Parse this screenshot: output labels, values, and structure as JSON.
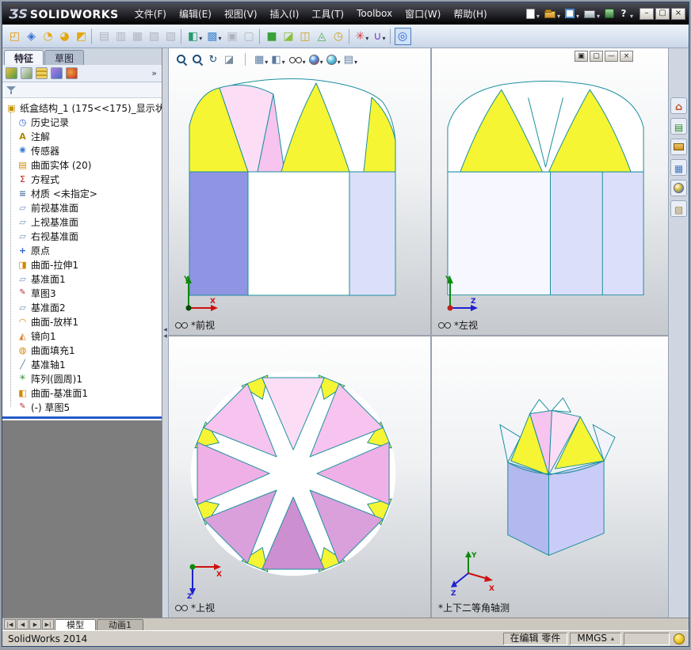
{
  "titlebar": {
    "logo_mark": "ƷS",
    "logo_name": "SOLIDWORKS",
    "quick_icons": [
      {
        "name": "new-document-button",
        "k": "q-new",
        "dd": true
      },
      {
        "name": "open-button",
        "k": "q-open",
        "dd": true
      },
      {
        "name": "make-drawing-button",
        "k": "q-opt",
        "dd": true
      },
      {
        "name": "print-button",
        "k": "q-print",
        "dd": true
      },
      {
        "name": "rebuild-button",
        "k": "q-reb",
        "dd": false
      },
      {
        "name": "help-button",
        "k": "q-help",
        "dd": true
      }
    ],
    "window_buttons": [
      {
        "name": "minimize-button",
        "g": "–"
      },
      {
        "name": "maximize-button",
        "g": "▢"
      },
      {
        "name": "close-button",
        "g": "×"
      }
    ]
  },
  "menubar": {
    "items": [
      {
        "name": "menu-file",
        "label": "文件(F)"
      },
      {
        "name": "menu-edit",
        "label": "编辑(E)"
      },
      {
        "name": "menu-view",
        "label": "视图(V)"
      },
      {
        "name": "menu-insert",
        "label": "插入(I)"
      },
      {
        "name": "menu-tools",
        "label": "工具(T)"
      },
      {
        "name": "menu-toolbox",
        "label": "Toolbox"
      },
      {
        "name": "menu-window",
        "label": "窗口(W)"
      },
      {
        "name": "menu-help",
        "label": "帮助(H)"
      }
    ]
  },
  "toolbar": {
    "items": [
      {
        "name": "toolbar-tool-button",
        "g": "◰",
        "c": "#e39a10"
      },
      {
        "name": "toolbar-tool-button",
        "g": "◈",
        "c": "#3a6fd0"
      },
      {
        "name": "toolbar-tool-button",
        "g": "◔",
        "c": "#e3a810"
      },
      {
        "name": "toolbar-tool-button",
        "g": "◕",
        "c": "#e3a810"
      },
      {
        "name": "toolbar-tool-button",
        "g": "◩",
        "c": "#e3a810"
      },
      {
        "name": "toolbar-separator",
        "cls": "sep",
        "it": "false"
      },
      {
        "name": "toolbar-tool-button",
        "g": "▤",
        "c": "#a7adb6",
        "cls": "disabled"
      },
      {
        "name": "toolbar-tool-button",
        "g": "▥",
        "c": "#a7adb6",
        "cls": "disabled"
      },
      {
        "name": "toolbar-tool-button",
        "g": "▦",
        "c": "#a7adb6",
        "cls": "disabled"
      },
      {
        "name": "toolbar-tool-button",
        "g": "▧",
        "c": "#a7adb6",
        "cls": "disabled"
      },
      {
        "name": "toolbar-tool-button",
        "g": "▨",
        "c": "#a7adb6",
        "cls": "disabled"
      },
      {
        "name": "toolbar-separator",
        "cls": "sep",
        "it": "false"
      },
      {
        "name": "toolbar-tool-button",
        "g": "◧",
        "c": "#2a9a6a",
        "dd": true
      },
      {
        "name": "toolbar-tool-button",
        "g": "▩",
        "c": "#4a8ad0",
        "dd": true
      },
      {
        "name": "toolbar-tool-button",
        "g": "▣",
        "c": "#a7adb6",
        "cls": "disabled"
      },
      {
        "name": "toolbar-tool-button",
        "g": "▢",
        "c": "#a7adb6",
        "cls": "disabled"
      },
      {
        "name": "toolbar-separator",
        "cls": "sep",
        "it": "false"
      },
      {
        "name": "toolbar-tool-button",
        "g": "■",
        "c": "#3aa03a"
      },
      {
        "name": "toolbar-tool-button",
        "g": "◪",
        "c": "#8ac03a"
      },
      {
        "name": "toolbar-tool-button",
        "g": "◫",
        "c": "#d0a020"
      },
      {
        "name": "toolbar-tool-button",
        "g": "◬",
        "c": "#50b050"
      },
      {
        "name": "toolbar-tool-button",
        "g": "◷",
        "c": "#d0a020"
      },
      {
        "name": "toolbar-separator",
        "cls": "sep",
        "it": "false"
      },
      {
        "name": "toolbar-tool-button",
        "g": "✳",
        "c": "#d04040",
        "dd": true
      },
      {
        "name": "toolbar-tool-button",
        "g": "∪",
        "c": "#8040c0",
        "dd": true
      },
      {
        "name": "toolbar-separator",
        "cls": "sep",
        "it": "false"
      },
      {
        "name": "toolbar-tool-button",
        "g": "◎",
        "c": "#2a5fd0",
        "cls": "selected"
      }
    ]
  },
  "left_panel": {
    "tabs": [
      {
        "name": "tab-features",
        "label": "特征",
        "cls": "active"
      },
      {
        "name": "tab-sketch",
        "label": "草图"
      }
    ],
    "manager_tabs": [
      {
        "name": "featuremanager-tab-ic​on",
        "k": "m-feat"
      },
      {
        "name": "propertymanager-tab-icon",
        "k": "m-prop"
      },
      {
        "name": "configurationmanager-tab-icon",
        "k": "m-config"
      },
      {
        "name": "displaymanager-tab-icon",
        "k": "m-disp"
      },
      {
        "name": "dimxpertmanager-tab-icon",
        "k": "m-dimx"
      }
    ],
    "overflow_label": "»",
    "tree": {
      "root": {
        "label": "纸盒结构_1 (175<<175)_显示状"
      },
      "items": [
        {
          "name": "tree-item-history",
          "icon": "i-history",
          "label": "历史记录"
        },
        {
          "name": "tree-item-annotations",
          "icon": "i-annot",
          "label": "注解"
        },
        {
          "name": "tree-item-sensors",
          "icon": "i-sensor",
          "label": "传感器"
        },
        {
          "name": "tree-item-surface-bodies",
          "icon": "i-bodies",
          "label": "曲面实体 (20)"
        },
        {
          "name": "tree-item-equations",
          "icon": "i-eq",
          "label": "方程式"
        },
        {
          "name": "tree-item-material",
          "icon": "i-material",
          "label": "材质 <未指定>"
        },
        {
          "name": "tree-item-front-plane",
          "icon": "i-plane",
          "label": "前视基准面"
        },
        {
          "name": "tree-item-top-plane",
          "icon": "i-plane",
          "label": "上视基准面"
        },
        {
          "name": "tree-item-right-plane",
          "icon": "i-plane",
          "label": "右视基准面"
        },
        {
          "name": "tree-item-origin",
          "icon": "i-origin",
          "label": "原点"
        },
        {
          "name": "tree-item-surface-extrude1",
          "icon": "i-extrude",
          "label": "曲面-拉伸1"
        },
        {
          "name": "tree-item-plane1",
          "icon": "i-plane",
          "label": "基准面1"
        },
        {
          "name": "tree-item-sketch3",
          "icon": "i-sketch",
          "label": "草图3"
        },
        {
          "name": "tree-item-plane2",
          "icon": "i-plane",
          "label": "基准面2"
        },
        {
          "name": "tree-item-surface-loft1",
          "icon": "i-loft",
          "label": "曲面-放样1"
        },
        {
          "name": "tree-item-mirror1",
          "icon": "i-mirror",
          "label": "镜向1"
        },
        {
          "name": "tree-item-surface-fill1",
          "icon": "i-fill",
          "label": "曲面填充1"
        },
        {
          "name": "tree-item-axis1",
          "icon": "i-axis",
          "label": "基准轴1"
        },
        {
          "name": "tree-item-circular-pattern1",
          "icon": "i-pattern",
          "label": "阵列(圆周)1"
        },
        {
          "name": "tree-item-surface-plane1",
          "icon": "i-surfplane",
          "label": "曲面-基准面1"
        },
        {
          "name": "tree-item-sketch5",
          "icon": "i-sketch",
          "label": "(-) 草图5"
        }
      ]
    }
  },
  "viewport_toolbar": {
    "buttons": [
      {
        "name": "zoom-fit-button",
        "k": "k-mag"
      },
      {
        "name": "zoom-area-button",
        "k": "k-magp"
      },
      {
        "name": "rotate-view-button",
        "k": "k-prev"
      },
      {
        "name": "section-view-button",
        "k": "k-sect"
      },
      {
        "name": "hud-separator",
        "k": "k-sep",
        "it": "false"
      },
      {
        "name": "view-orientation-button",
        "k": "k-orient",
        "dd": true
      },
      {
        "name": "display-style-button",
        "k": "k-disp",
        "dd": true
      },
      {
        "name": "hide-show-items-button",
        "k": "k-glasses",
        "dd": true
      },
      {
        "name": "edit-appearance-button",
        "k": "k-ball1",
        "dd": true
      },
      {
        "name": "apply-scene-button",
        "k": "k-ball2",
        "dd": true
      },
      {
        "name": "view-settings-button",
        "k": "k-cam",
        "dd": true
      }
    ]
  },
  "viewport_controls": [
    {
      "name": "viewport-restore-button",
      "g": "▣"
    },
    {
      "name": "viewport-split-button",
      "g": "▢"
    },
    {
      "name": "viewport-minimize-button",
      "g": "—"
    },
    {
      "name": "viewport-close-button",
      "g": "×"
    }
  ],
  "viewports": {
    "front": {
      "label": "*前视"
    },
    "left": {
      "label": "*左视"
    },
    "top": {
      "label": "*上视"
    },
    "iso": {
      "label": "*上下二等角轴测"
    }
  },
  "task_pane": {
    "icons": [
      {
        "name": "solidworks-resources-tab",
        "k": "tp-home"
      },
      {
        "name": "design-library-tab",
        "k": "tp-lib"
      },
      {
        "name": "file-explorer-tab",
        "k": "tp-exp"
      },
      {
        "name": "view-palette-tab",
        "k": "tp-pal"
      },
      {
        "name": "appearances-tab",
        "k": "tp-app"
      },
      {
        "name": "custom-properties-tab",
        "k": "tp-props"
      }
    ]
  },
  "bottom_tabs": {
    "nav": [
      {
        "name": "first-tab-button",
        "g": "|◀"
      },
      {
        "name": "prev-tab-button",
        "g": "◀"
      },
      {
        "name": "next-tab-button",
        "g": "▶"
      },
      {
        "name": "last-tab-button",
        "g": "▶|"
      }
    ],
    "tabs": [
      {
        "name": "tab-model",
        "label": "模型",
        "cls": "active"
      },
      {
        "name": "tab-motion1",
        "label": "动画1"
      }
    ]
  },
  "statusbar": {
    "app": "SolidWorks 2014",
    "editing": "在编辑 零件",
    "units": "MMGS"
  },
  "colors": {
    "edge_teal": "#1b8f9e",
    "model_yellow": "#f5f533",
    "model_lavender": "#c9ccf6",
    "model_pink": "#f6c4ee",
    "selected_face_blue": "#8f95e2",
    "rollback_bar_blue": "#2458c8"
  }
}
